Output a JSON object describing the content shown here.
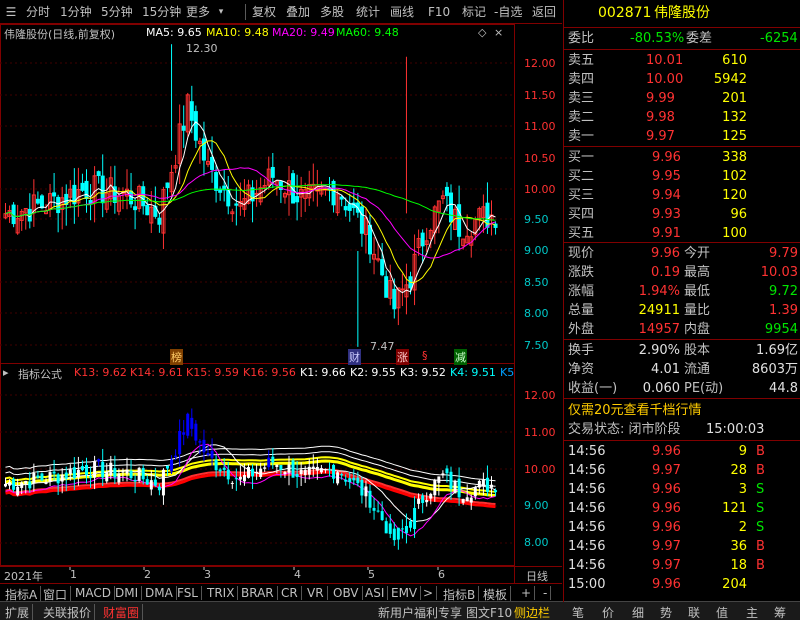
{
  "toolbar": {
    "items": [
      "分时",
      "1分钟",
      "5分钟",
      "15分钟",
      "更多",
      "复权",
      "叠加",
      "多股",
      "统计",
      "画线",
      "F10",
      "标记",
      "-自选",
      "返回"
    ]
  },
  "main": {
    "stock_label": "伟隆股份(日线,前复权)",
    "ma5": "MA5: 9.65",
    "ma10": "MA10: 9.48",
    "ma20": "MA20: 9.49",
    "ma60": "MA60: 9.48",
    "high_marker": "12.30",
    "low_marker": "7.47",
    "price_axis": [
      "12.00",
      "11.50",
      "11.00",
      "10.50",
      "10.00",
      "9.50",
      "9.00",
      "8.50",
      "8.00",
      "7.50"
    ],
    "event_tags": [
      "榜",
      "财",
      "涨",
      "§",
      "减"
    ]
  },
  "indicator": {
    "name": "指标公式",
    "k13": "K13: 9.62",
    "k14": "K14: 9.61",
    "k15": "K15: 9.59",
    "k16": "K16: 9.56",
    "k1": "K1: 9.66",
    "k2": "K2: 9.55",
    "k3": "K3: 9.52",
    "k4": "K4: 9.51",
    "k5": "K5",
    "price_axis": [
      "12.00",
      "11.00",
      "10.00",
      "9.00",
      "8.00"
    ]
  },
  "timeline": {
    "labels": [
      "2021年",
      "1",
      "2",
      "3",
      "4",
      "5",
      "6"
    ],
    "period": "日线"
  },
  "bottom_tabs": [
    "指标A",
    "窗口",
    "MACD",
    "DMI",
    "DMA",
    "FSL",
    "TRIX",
    "BRAR",
    "CR",
    "VR",
    "OBV",
    "ASI",
    "EMV",
    ">",
    "指标B",
    "模板",
    "+",
    "-"
  ],
  "bottom_bar2": {
    "left": [
      "扩展",
      "关联报价",
      "财富圈"
    ],
    "center": [
      "新用户福利专享",
      "图文F10",
      "侧边栏"
    ],
    "right": [
      "笔",
      "价",
      "细",
      "势",
      "联",
      "值",
      "主",
      "筹"
    ]
  },
  "quote": {
    "code": "002871",
    "name": "伟隆股份",
    "weibi_label": "委比",
    "weibi": "-80.53%",
    "weicha_label": "委差",
    "weicha": "-6254",
    "sell": [
      {
        "label": "卖五",
        "price": "10.01",
        "vol": "610"
      },
      {
        "label": "卖四",
        "price": "10.00",
        "vol": "5942"
      },
      {
        "label": "卖三",
        "price": "9.99",
        "vol": "201"
      },
      {
        "label": "卖二",
        "price": "9.98",
        "vol": "132"
      },
      {
        "label": "卖一",
        "price": "9.97",
        "vol": "125"
      }
    ],
    "buy": [
      {
        "label": "买一",
        "price": "9.96",
        "vol": "338"
      },
      {
        "label": "买二",
        "price": "9.95",
        "vol": "102"
      },
      {
        "label": "买三",
        "price": "9.94",
        "vol": "120"
      },
      {
        "label": "买四",
        "price": "9.93",
        "vol": "96"
      },
      {
        "label": "买五",
        "price": "9.91",
        "vol": "100"
      }
    ],
    "stats": [
      {
        "l1": "现价",
        "v1": "9.96",
        "l2": "今开",
        "v2": "9.79"
      },
      {
        "l1": "涨跌",
        "v1": "0.19",
        "l2": "最高",
        "v2": "10.03"
      },
      {
        "l1": "涨幅",
        "v1": "1.94%",
        "l2": "最低",
        "v2": "9.72"
      },
      {
        "l1": "总量",
        "v1": "24911",
        "l2": "量比",
        "v2": "1.39"
      },
      {
        "l1": "外盘",
        "v1": "14957",
        "l2": "内盘",
        "v2": "9954"
      }
    ],
    "stats2": [
      {
        "l1": "换手",
        "v1": "2.90%",
        "l2": "股本",
        "v2": "1.69亿"
      },
      {
        "l1": "净资",
        "v1": "4.01",
        "l2": "流通",
        "v2": "8603万"
      },
      {
        "l1": "收益(一)",
        "v1": "0.060",
        "l2": "PE(动)",
        "v2": "44.8"
      }
    ],
    "promo": "仅需20元查看千档行情",
    "status_label": "交易状态: 闭市阶段",
    "status_time": "15:00:03",
    "ticks": [
      {
        "t": "14:56",
        "p": "9.96",
        "v": "9",
        "d": "B"
      },
      {
        "t": "14:56",
        "p": "9.97",
        "v": "28",
        "d": "B"
      },
      {
        "t": "14:56",
        "p": "9.96",
        "v": "3",
        "d": "S"
      },
      {
        "t": "14:56",
        "p": "9.96",
        "v": "121",
        "d": "S"
      },
      {
        "t": "14:56",
        "p": "9.96",
        "v": "2",
        "d": "S"
      },
      {
        "t": "14:56",
        "p": "9.97",
        "v": "36",
        "d": "B"
      },
      {
        "t": "14:56",
        "p": "9.97",
        "v": "18",
        "d": "B"
      },
      {
        "t": "15:00",
        "p": "9.96",
        "v": "204",
        "d": ""
      }
    ]
  },
  "colors": {
    "up": "#ff3232",
    "down": "#00ffff",
    "ma5": "#ffffff",
    "ma10": "#ffff00",
    "ma20": "#ff00ff",
    "ma60": "#00ff00",
    "grid": "#800000"
  }
}
